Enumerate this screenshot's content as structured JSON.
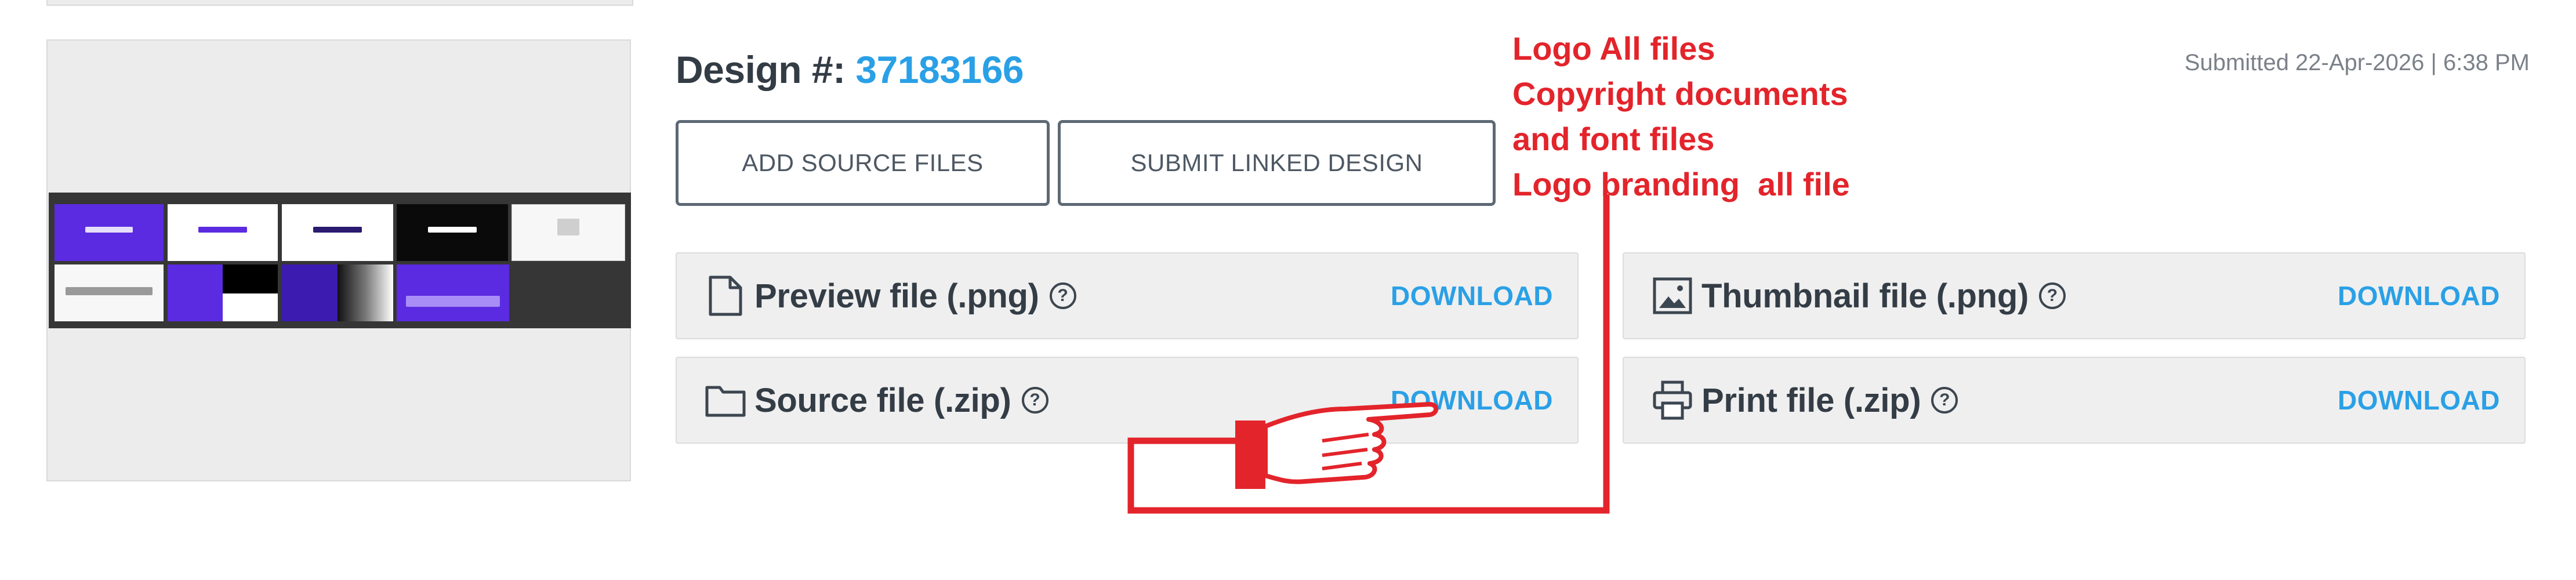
{
  "design": {
    "title_prefix": "Design #: ",
    "number": "37183166",
    "submitted": "Submitted 22-Apr-2026 | 6:38 PM"
  },
  "buttons": {
    "add_source": "ADD SOURCE FILES",
    "submit_linked": "SUBMIT LINKED DESIGN"
  },
  "annotation": {
    "lines": [
      "Logo All files",
      "Copyright documents",
      "and font files",
      "Logo branding  all file"
    ],
    "color": "#e3242b"
  },
  "files": {
    "preview": {
      "label": "Preview file (.png)",
      "icon": "document-icon",
      "action": "DOWNLOAD"
    },
    "source": {
      "label": "Source file (.zip)",
      "icon": "folder-icon",
      "action": "DOWNLOAD"
    },
    "thumbnail": {
      "label": "Thumbnail file (.png)",
      "icon": "image-icon",
      "action": "DOWNLOAD"
    },
    "print": {
      "label": "Print file (.zip)",
      "icon": "printer-icon",
      "action": "DOWNLOAD"
    }
  },
  "help_glyph": "?",
  "colors": {
    "accent": "#2aa0e6",
    "text": "#333c45",
    "card_bg": "#efefef",
    "thumb_brand": "#5a2be0"
  }
}
